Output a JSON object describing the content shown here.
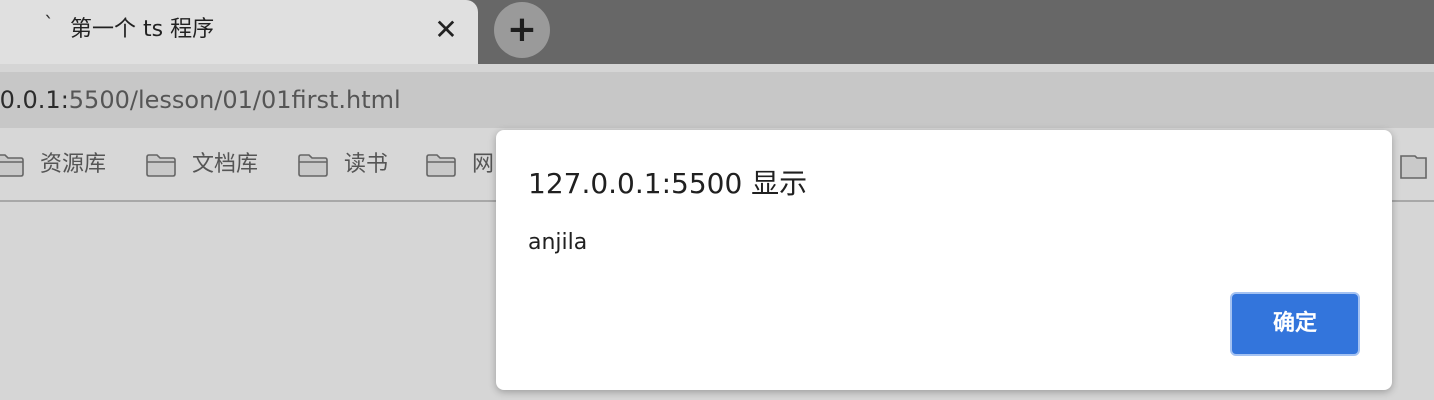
{
  "tab": {
    "title": "第一个 ts 程序",
    "favicon": "spinner-icon",
    "close_label": "✕"
  },
  "new_tab": {
    "label": "+"
  },
  "address_bar": {
    "url_host": ".0.0.1:",
    "url_rest": "5500/lesson/01/01first.html"
  },
  "bookmarks": [
    {
      "label": "资源库"
    },
    {
      "label": "文档库"
    },
    {
      "label": "读书"
    },
    {
      "label": "网"
    }
  ],
  "dialog": {
    "title": "127.0.0.1:5500 显示",
    "message": "anjila",
    "ok_label": "确定"
  },
  "colors": {
    "accent": "#3375dc",
    "tab_strip": "#676767",
    "tab_active": "#e0e0e0"
  }
}
